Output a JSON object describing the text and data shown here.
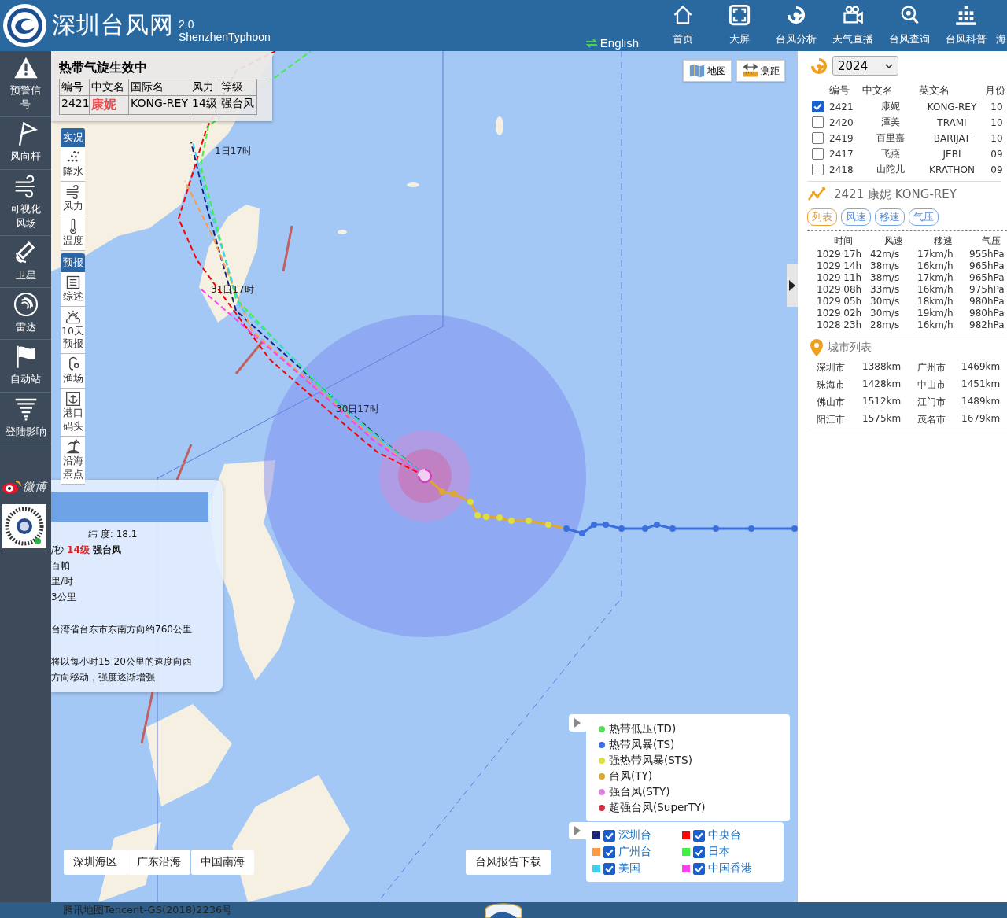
{
  "header": {
    "title": "深圳台风网",
    "version": "2.0",
    "subtitle": "ShenzhenTyphoon",
    "language_link": "English",
    "nav": [
      {
        "label": "首页",
        "kind": "home"
      },
      {
        "label": "大屏",
        "kind": "screen"
      },
      {
        "label": "台风分析",
        "kind": "typhoon"
      },
      {
        "label": "天气直播",
        "kind": "camera"
      },
      {
        "label": "台风查询",
        "kind": "search"
      },
      {
        "label": "台风科普",
        "kind": "bars"
      },
      {
        "label": "海",
        "kind": "none"
      }
    ]
  },
  "sidebar": {
    "items": [
      {
        "label": "预警信号",
        "kind": "warning"
      },
      {
        "label": "风向杆",
        "kind": "pennant"
      },
      {
        "label": "可视化风场",
        "kind": "wind"
      },
      {
        "label": "卫星",
        "kind": "satellite"
      },
      {
        "label": "雷达",
        "kind": "radar"
      },
      {
        "label": "自动站",
        "kind": "flag"
      },
      {
        "label": "登陆影响",
        "kind": "tornado"
      }
    ],
    "weibo": "微博"
  },
  "active_panel": {
    "title": "热带气旋生效中",
    "columns": [
      "编号",
      "中文名",
      "国际名",
      "风力",
      "等级"
    ],
    "cells": [
      {
        "text": "2421",
        "kind": "plain"
      },
      {
        "text": "康妮",
        "kind": "name"
      },
      {
        "text": "KONG-REY",
        "kind": "plain"
      },
      {
        "text": "14级",
        "kind": "plain"
      },
      {
        "text": "强台风",
        "kind": "plain"
      }
    ]
  },
  "map_toolbar": [
    {
      "title": "实况",
      "items": [
        {
          "label": "降水",
          "kind": "rain"
        },
        {
          "label": "风力",
          "kind": "wind"
        },
        {
          "label": "温度",
          "kind": "thermometer"
        }
      ]
    },
    {
      "title": "预报",
      "items": [
        {
          "label": "综述",
          "kind": "doc"
        },
        {
          "label": "10天预报",
          "kind": "cloud"
        },
        {
          "label": "渔场",
          "kind": "hook"
        },
        {
          "label": "港口码头",
          "kind": "anchor"
        },
        {
          "label": "沿海景点",
          "kind": "palm"
        }
      ]
    }
  ],
  "map_controls": [
    {
      "label": "地图",
      "kind": "map"
    },
    {
      "label": "测距",
      "kind": "ruler"
    }
  ],
  "track_labels": [
    "1日17时",
    "31日17时",
    "30日17时"
  ],
  "info_panel": {
    "latitude": "纬 度: 18.1",
    "speed_unit": "/秒",
    "grade": "14级",
    "grade_name": "强台风",
    "lines": [
      "百帕",
      "里/时",
      "3公里",
      "台湾省台东市东南方向约760公里",
      "将以每小时15-20公里的速度向西",
      "方向移动，强度逐渐增强"
    ]
  },
  "year_select": "2024",
  "typhoon_list": {
    "columns": [
      "编号",
      "中文名",
      "英文名",
      "月份"
    ],
    "rows": [
      {
        "number": "2421",
        "cn": "康妮",
        "en": "KONG-REY",
        "month": "10",
        "checked": true
      },
      {
        "number": "2420",
        "cn": "潭美",
        "en": "TRAMI",
        "month": "10",
        "checked": false
      },
      {
        "number": "2419",
        "cn": "百里嘉",
        "en": "BARIJAT",
        "month": "10",
        "checked": false
      },
      {
        "number": "2417",
        "cn": "飞燕",
        "en": "JEBI",
        "month": "09",
        "checked": false
      },
      {
        "number": "2418",
        "cn": "山陀儿",
        "en": "KRATHON",
        "month": "09",
        "checked": false
      }
    ]
  },
  "selected_typhoon": "2421 康妮 KONG-REY",
  "view_tabs": [
    {
      "label": "列表",
      "selected": true
    },
    {
      "label": "风速",
      "selected": false
    },
    {
      "label": "移速",
      "selected": false
    },
    {
      "label": "气压",
      "selected": false
    }
  ],
  "track_table": {
    "columns": [
      "时间",
      "风速",
      "移速",
      "气压"
    ],
    "rows": [
      [
        "1029 17h",
        "42m/s",
        "17km/h",
        "955hPa"
      ],
      [
        "1029 14h",
        "38m/s",
        "16km/h",
        "965hPa"
      ],
      [
        "1029 11h",
        "38m/s",
        "17km/h",
        "965hPa"
      ],
      [
        "1029 08h",
        "33m/s",
        "16km/h",
        "975hPa"
      ],
      [
        "1029 05h",
        "30m/s",
        "18km/h",
        "980hPa"
      ],
      [
        "1029 02h",
        "30m/s",
        "19km/h",
        "980hPa"
      ],
      [
        "1028 23h",
        "28m/s",
        "16km/h",
        "982hPa"
      ]
    ]
  },
  "city_list": {
    "title": "城市列表",
    "cities": [
      {
        "name": "深圳市",
        "distance": "1388km"
      },
      {
        "name": "广州市",
        "distance": "1469km"
      },
      {
        "name": "珠海市",
        "distance": "1428km"
      },
      {
        "name": "中山市",
        "distance": "1451km"
      },
      {
        "name": "佛山市",
        "distance": "1512km"
      },
      {
        "name": "江门市",
        "distance": "1489km"
      },
      {
        "name": "阳江市",
        "distance": "1575km"
      },
      {
        "name": "茂名市",
        "distance": "1679km"
      }
    ]
  },
  "legend": {
    "levels": [
      {
        "label": "热带低压(TD)",
        "color": "#55e055"
      },
      {
        "label": "热带风暴(TS)",
        "color": "#3a6fe0"
      },
      {
        "label": "强热带风暴(STS)",
        "color": "#dede40"
      },
      {
        "label": "台风(TY)",
        "color": "#e0a830"
      },
      {
        "label": "强台风(STY)",
        "color": "#e080e0"
      },
      {
        "label": "超强台风(SuperTY)",
        "color": "#d03040"
      }
    ],
    "agencies": [
      {
        "label": "深圳台",
        "color": "#1a2380",
        "checked": true
      },
      {
        "label": "中央台",
        "color": "#ff0000",
        "checked": true
      },
      {
        "label": "广州台",
        "color": "#ff9a40",
        "checked": true
      },
      {
        "label": "日本",
        "color": "#40f040",
        "checked": true
      },
      {
        "label": "美国",
        "color": "#40d0f0",
        "checked": true
      },
      {
        "label": "中国香港",
        "color": "#ff40f0",
        "checked": true
      }
    ]
  },
  "region_buttons": [
    "深圳海区",
    "广东沿海",
    "中国南海"
  ],
  "report_button": "台风报告下载",
  "footer": "腾讯地图Tencent-GS(2018)2236号"
}
